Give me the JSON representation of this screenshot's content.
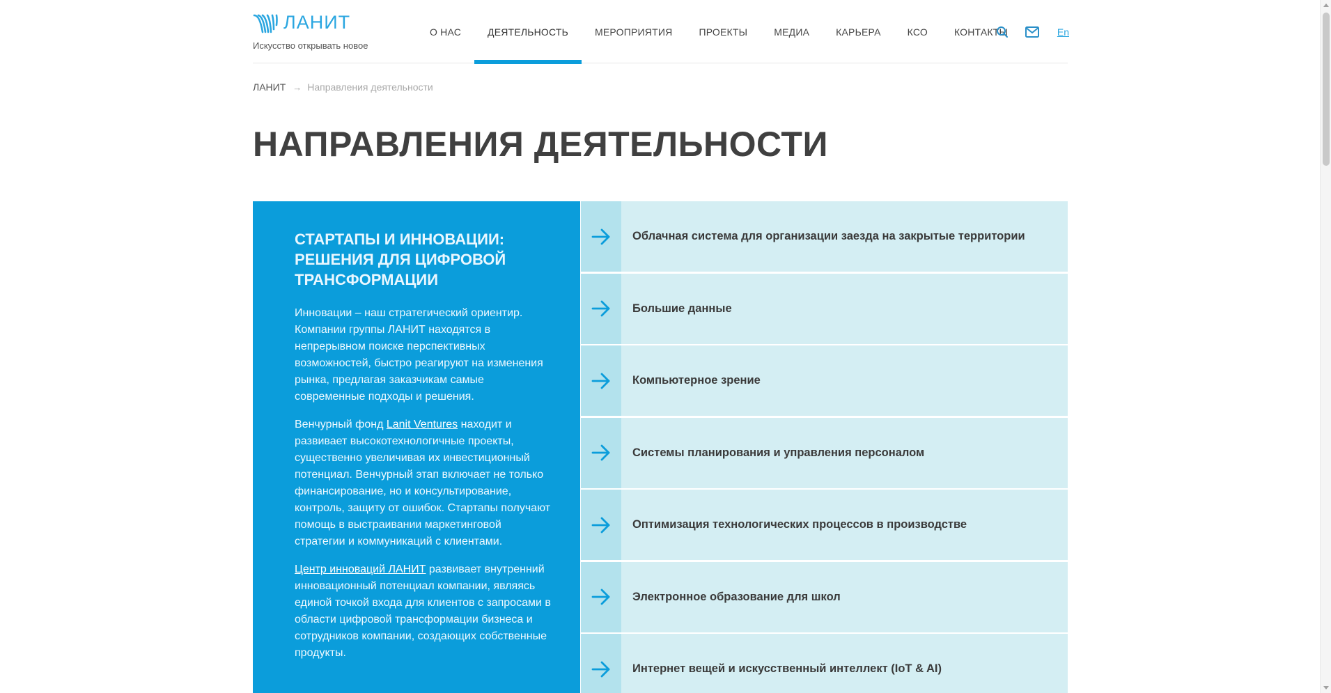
{
  "header": {
    "logo_text": "ЛАНИТ",
    "tagline": "Искусство открывать новое",
    "nav": [
      {
        "label": "О нас",
        "active": false
      },
      {
        "label": "Деятельность",
        "active": true
      },
      {
        "label": "Мероприятия",
        "active": false
      },
      {
        "label": "Проекты",
        "active": false
      },
      {
        "label": "Медиа",
        "active": false
      },
      {
        "label": "Карьера",
        "active": false
      },
      {
        "label": "КСО",
        "active": false
      },
      {
        "label": "Контакты",
        "active": false
      }
    ],
    "lang": "En",
    "icons": [
      "search-icon",
      "mail-icon"
    ],
    "accent_color": "#0b9ddb"
  },
  "breadcrumb": {
    "home": "ЛАНИТ",
    "current": "Направления деятельности"
  },
  "page_title": "Направления деятельности",
  "card": {
    "title": "СТАРТАПЫ И ИННОВАЦИИ: РЕШЕНИЯ ДЛЯ ЦИФРОВОЙ ТРАНСФОРМАЦИИ",
    "p1": "Инновации – наш стратегический ориентир. Компании группы ЛАНИТ находятся в непрерывном поиске перспективных возможностей, быстро реагируют на изменения рынка, предлагая заказчикам самые современные подходы и решения.",
    "p2_before": "Венчурный фонд ",
    "p2_link": "Lanit Ventures",
    "p2_after": " находит и развивает высокотехнологичные проекты, существенно увеличивая их инвестиционный потенциал. Венчурный этап включает не только финансирование, но и консультирование, контроль, защиту от ошибок. Стартапы получают помощь в выстраивании маркетинговой стратегии и коммуникаций с клиентами.",
    "p3_link": "Центр инноваций ЛАНИТ",
    "p3_after": " развивает внутренний инновационный потенциал компании, являясь единой точкой входа для клиентов с запросами в области цифровой трансформации бизнеса и сотрудников компании, создающих собственные продукты.",
    "background_color": "#0b9ddb"
  },
  "directions": [
    "Облачная система для организации заезда на закрытые территории",
    "Большие данные",
    "Компьютерное зрение",
    "Системы планирования и управления персоналом",
    "Оптимизация технологических процессов в производстве",
    "Электронное образование для школ",
    "Интернет вещей и искусственный интеллект (IoT & AI)"
  ]
}
